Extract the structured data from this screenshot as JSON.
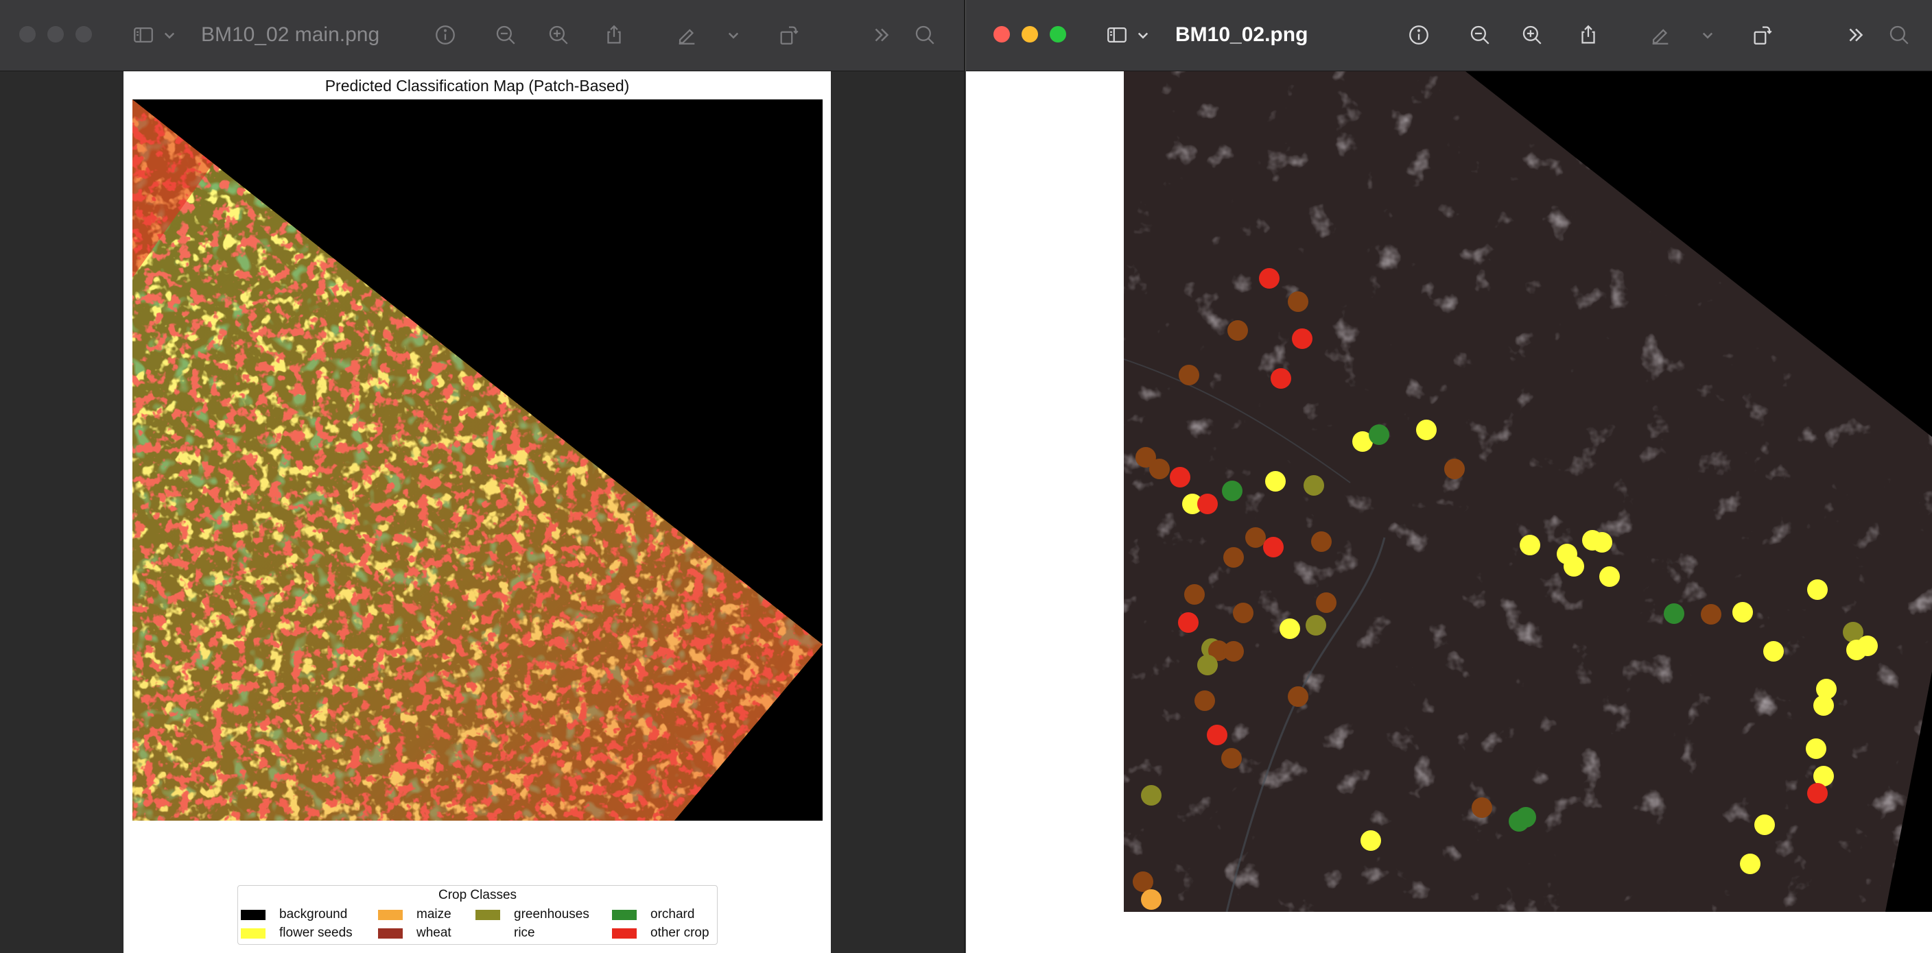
{
  "left_window": {
    "title": "BM10_02 main.png",
    "toolbar": {
      "sidebar": "sidebar-icon",
      "chevron": "chevron-down-icon",
      "info": "info-icon",
      "zoom_out": "zoom-out-icon",
      "zoom_in": "zoom-in-icon",
      "share": "share-icon",
      "markup": "pen-icon",
      "rotate": "rotate-icon",
      "more": "more-chevrons-icon",
      "search": "search-icon"
    },
    "figure": {
      "title": "Predicted Classification Map (Patch-Based)",
      "legend": {
        "title": "Crop Classes",
        "items": [
          {
            "label": "background",
            "color": "#000000"
          },
          {
            "label": "flower seeds",
            "color": "#ffff3d"
          },
          {
            "label": "maize",
            "color": "#f5a93a"
          },
          {
            "label": "wheat",
            "color": "#9a3024"
          },
          {
            "label": "greenhouses",
            "color": "#8a8a26"
          },
          {
            "label": "rice",
            "color": "#ffffff"
          },
          {
            "label": "orchard",
            "color": "#2f8b2f"
          },
          {
            "label": "other crop",
            "color": "#e8281d"
          }
        ]
      }
    }
  },
  "right_window": {
    "title": "BM10_02.png",
    "traffic_lights": {
      "close": "#ff5f57",
      "minimize": "#febc2e",
      "zoom": "#28c840"
    }
  },
  "colors": {
    "toolbar": "#3a3a3c",
    "window_bg": "#2b2b2b",
    "inactive_title": "#8a8a8d",
    "active_title": "#ffffff"
  }
}
